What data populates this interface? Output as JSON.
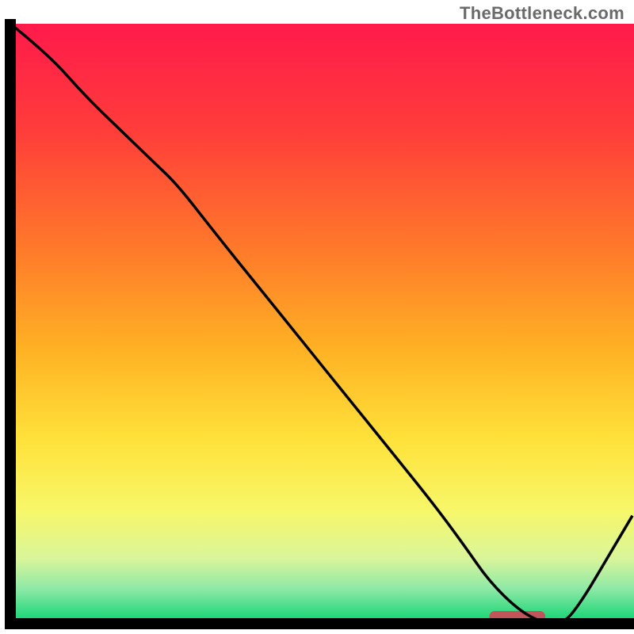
{
  "watermark": "TheBottleneck.com",
  "chart_data": {
    "type": "line",
    "title": "",
    "xlabel": "",
    "ylabel": "",
    "xlim": [
      0,
      100
    ],
    "ylim": [
      0,
      100
    ],
    "x": [
      0,
      6,
      12,
      18,
      23,
      27,
      33,
      40,
      47,
      54,
      61,
      68,
      73,
      77,
      82,
      86,
      89,
      92,
      96,
      100
    ],
    "values": [
      100,
      95,
      88,
      82,
      77,
      73,
      65,
      56,
      47,
      38,
      29,
      20,
      13,
      7,
      2,
      0,
      0,
      4,
      11,
      18
    ],
    "gradient_stops": [
      {
        "offset": 0.0,
        "color": "#ff1a4b"
      },
      {
        "offset": 0.18,
        "color": "#ff3d3a"
      },
      {
        "offset": 0.38,
        "color": "#ff7a2a"
      },
      {
        "offset": 0.55,
        "color": "#ffb224"
      },
      {
        "offset": 0.7,
        "color": "#ffe23a"
      },
      {
        "offset": 0.82,
        "color": "#f7f76a"
      },
      {
        "offset": 0.9,
        "color": "#d9f59a"
      },
      {
        "offset": 0.95,
        "color": "#8fe9a6"
      },
      {
        "offset": 1.0,
        "color": "#1fd67a"
      }
    ],
    "marker": {
      "x_start": 77,
      "x_end": 86,
      "y": 0,
      "color": "#c1555a"
    },
    "axis": {
      "color": "#000000",
      "width": 14
    },
    "curve": {
      "color": "#000000",
      "width": 3.5
    }
  }
}
